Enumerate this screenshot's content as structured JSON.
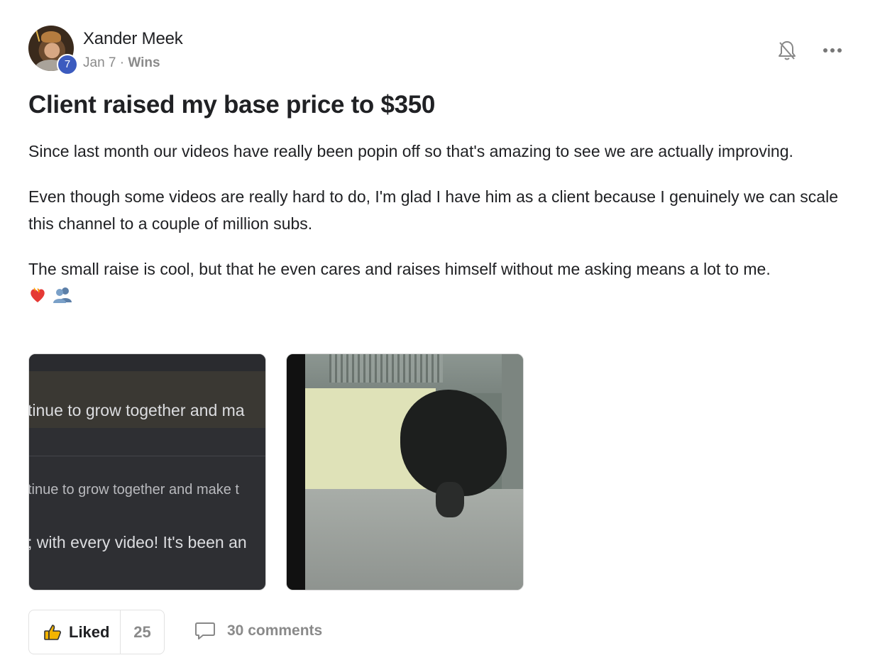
{
  "post": {
    "author": "Xander Meek",
    "level": "7",
    "date": "Jan 7",
    "separator": "·",
    "category": "Wins",
    "title": "Client raised my base price to $350",
    "paragraphs": [
      "Since last month our videos have really been popin off so that's amazing to see we are actually improving.",
      "Even though some videos are really hard to do, I'm glad I have him as a client because I genuinely we can scale this channel to a couple of million subs.",
      "The small raise is cool, but that he even cares and raises himself without me asking means a lot to me."
    ],
    "emojis": [
      "heart-on-fire-emoji",
      "busts-in-silhouette-emoji"
    ],
    "attachments": [
      {
        "type": "screenshot",
        "lines": [
          "tinue to grow together and ma",
          "tinue to grow together and make t",
          "; with every video! It's been an"
        ]
      },
      {
        "type": "gif"
      }
    ]
  },
  "actions": {
    "like_label": "Liked",
    "like_count": "25",
    "comments_label": "30 comments"
  },
  "icons": {
    "bell": "bell-off-icon",
    "more": "more-horizontal-icon",
    "like": "thumbs-up-icon",
    "comment": "comment-icon"
  },
  "colors": {
    "level_badge": "#3c5bbf",
    "muted_text": "#8a8a8a",
    "like_icon": "#f4b400"
  }
}
